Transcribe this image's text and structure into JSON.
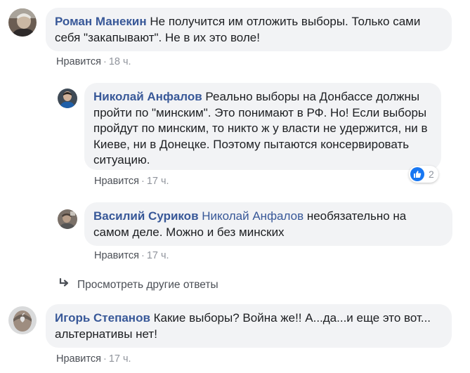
{
  "comments": [
    {
      "author": "Роман Манекин",
      "text": "Не получится им отложить выборы. Только сами себя \"закапывают\". Не в их это воле!",
      "like_label": "Нравится",
      "time": "18 ч."
    },
    {
      "author": "Николай Анфалов",
      "text": "Реально выборы на Донбассе должны пройти по \"минским\". Это понимают в РФ. Но! Если выборы пройдут по минским, то никто ж у власти не удержится, ни в Киеве, ни в Донецке. Поэтому пытаются консервировать ситуацию.",
      "like_label": "Нравится",
      "time": "17 ч.",
      "reaction_count": "2"
    },
    {
      "author": "Василий Суриков",
      "mention": "Николай Анфалов",
      "text": "необязательно на самом деле. Можно и без минских",
      "like_label": "Нравится",
      "time": "17 ч."
    },
    {
      "author": "Игорь Степанов",
      "text": "Какие выборы? Война же!! А...да...и еще это вот... альтернативы нет!",
      "like_label": "Нравится",
      "time": "17 ч."
    }
  ],
  "more_replies": {
    "label": "Просмотреть другие ответы",
    "icon": "reply-arrow-icon"
  },
  "colors": {
    "link": "#385898",
    "bubble": "#f2f3f5",
    "meta": "#90949c",
    "like_badge": "#1877f2"
  }
}
